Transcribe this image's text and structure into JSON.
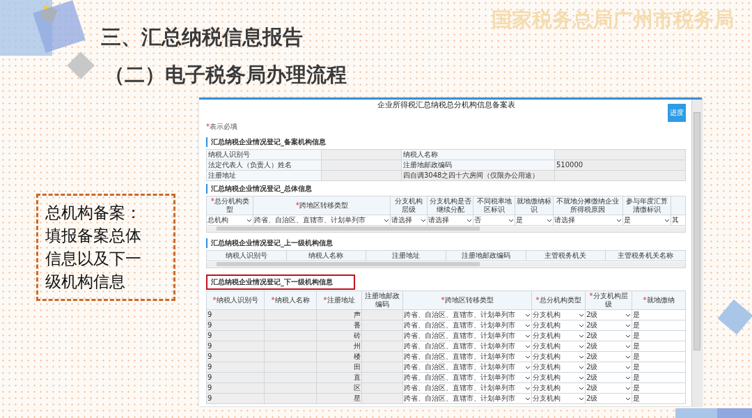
{
  "slide": {
    "title": "三、汇总纳税信息报告",
    "subtitle": "（二）电子税务局办理流程",
    "brand": "国家税务总局广州市税务局",
    "note": "总机构备案：填报备案总体信息以及下一级机构信息"
  },
  "form": {
    "title": "企业所得税汇总纳税总分机构信息备案表",
    "progress_button": "进度",
    "required_mark": "*",
    "required_note": "表示必填",
    "sections": [
      {
        "kind": "info",
        "title": "汇总纳税企业情况登记_备案机构信息",
        "highlighted": false,
        "rows": [
          [
            {
              "kind": "label",
              "text": "纳税人识别号"
            },
            {
              "kind": "redacted"
            },
            {
              "kind": "label",
              "text": "纳税人名称"
            },
            {
              "kind": "redacted"
            }
          ],
          [
            {
              "kind": "label",
              "text": "法定代表人（负责人）姓名"
            },
            {
              "kind": "redacted"
            },
            {
              "kind": "label",
              "text": "注册地邮政编码"
            },
            {
              "kind": "value",
              "text": "510000"
            }
          ],
          [
            {
              "kind": "label",
              "text": "注册地址"
            },
            {
              "kind": "redacted"
            },
            {
              "kind": "value",
              "text": "四自调3048之四十六房间（仅限办公用途）"
            },
            {
              "kind": "redacted"
            }
          ]
        ]
      },
      {
        "kind": "general",
        "title": "汇总纳税企业情况登记_总体信息",
        "highlighted": false,
        "columns": [
          {
            "label": "总分机构类型",
            "mark": "*"
          },
          {
            "label": "跨地区转移类型",
            "mark": "*"
          },
          {
            "label": "分支机构层级"
          },
          {
            "label": "分支机构是否继续分配"
          },
          {
            "label": "不同税率地区标识"
          },
          {
            "label": "就地缴纳标识"
          },
          {
            "label": "不就地分摊缴纳企业所得税原因"
          },
          {
            "label": "参与年度汇算清缴标识"
          }
        ],
        "values": [
          {
            "kind": "select",
            "text": "总机构"
          },
          {
            "kind": "select",
            "text": "跨省、自治区、直辖市、计划单列市"
          },
          {
            "kind": "select",
            "text": "请选择"
          },
          {
            "kind": "select",
            "text": "请选择"
          },
          {
            "kind": "select",
            "text": "否"
          },
          {
            "kind": "select",
            "text": "是"
          },
          {
            "kind": "select",
            "text": "请选择"
          },
          {
            "kind": "select",
            "text": "是"
          },
          {
            "kind": "text",
            "text": "其"
          }
        ]
      },
      {
        "kind": "upper",
        "title": "汇总纳税企业情况登记_上一级机构信息",
        "highlighted": false,
        "columns": [
          {
            "label": "纳税人识别号"
          },
          {
            "label": "纳税人名称"
          },
          {
            "label": "注册地址"
          },
          {
            "label": "注册地邮政编码"
          },
          {
            "label": "主管税务机关"
          },
          {
            "label": "主管税务机关名称"
          }
        ]
      },
      {
        "kind": "lower",
        "title": "汇总纳税企业情况登记_下一级机构信息",
        "highlighted": true,
        "columns": [
          {
            "label": "纳税人识别号",
            "mark": "*"
          },
          {
            "label": "纳税人名称",
            "mark": "*"
          },
          {
            "label": "注册地址",
            "mark": "*"
          },
          {
            "label": "注册地邮政编码"
          },
          {
            "label": "跨地区转移类型",
            "mark": "*"
          },
          {
            "label": "总分机构类型",
            "mark": "*"
          },
          {
            "label": "分支机构层级",
            "mark": "*"
          },
          {
            "label": "就地缴纳",
            "mark": "*"
          }
        ],
        "rows": [
          {
            "id": "9",
            "address": "声",
            "transfer_type": "跨省、自治区、直辖市、计划单列市",
            "org_type": "分支机构",
            "level": "2级",
            "local": "是"
          },
          {
            "id": "9",
            "address": "番",
            "transfer_type": "跨省、自治区、直辖市、计划单列市",
            "org_type": "分支机构",
            "level": "2级",
            "local": "是"
          },
          {
            "id": "9",
            "address": "砖",
            "transfer_type": "跨省、自治区、直辖市、计划单列市",
            "org_type": "分支机构",
            "level": "2级",
            "local": "是"
          },
          {
            "id": "9",
            "address": "州",
            "transfer_type": "跨省、自治区、直辖市、计划单列市",
            "org_type": "分支机构",
            "level": "2级",
            "local": "是"
          },
          {
            "id": "9",
            "address": "楼",
            "transfer_type": "跨省、自治区、直辖市、计划单列市",
            "org_type": "分支机构",
            "level": "2级",
            "local": "是"
          },
          {
            "id": "9",
            "address": "田",
            "transfer_type": "跨省、自治区、直辖市、计划单列市",
            "org_type": "分支机构",
            "level": "2级",
            "local": "是"
          },
          {
            "id": "9",
            "address": "直",
            "transfer_type": "跨省、自治区、直辖市、计划单列市",
            "org_type": "分支机构",
            "level": "2级",
            "local": "是"
          },
          {
            "id": "9",
            "address": "区",
            "transfer_type": "跨省、自治区、直辖市、计划单列市",
            "org_type": "分支机构",
            "level": "2级",
            "local": "是"
          },
          {
            "id": "9",
            "address": "星",
            "transfer_type": "跨省、自治区、直辖市、计划单列市",
            "org_type": "分支机构",
            "level": "2级",
            "local": "是"
          }
        ]
      }
    ]
  }
}
